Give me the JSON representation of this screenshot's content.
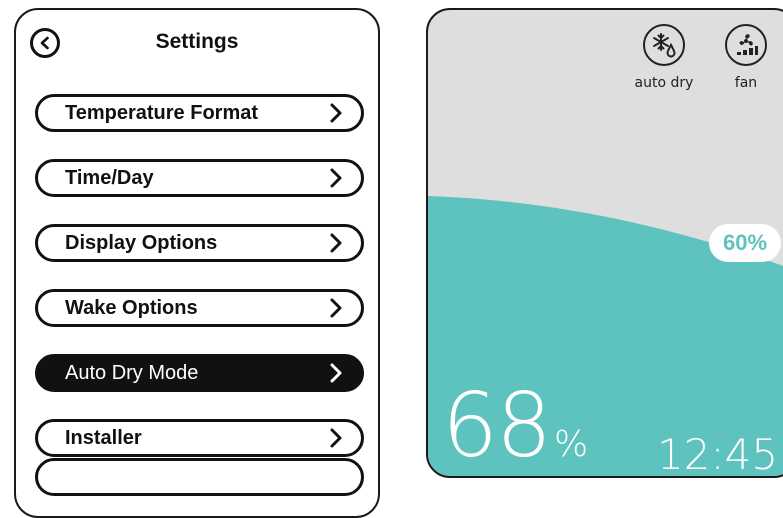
{
  "settings": {
    "title": "Settings",
    "back_icon": "chevron-left-icon",
    "items": [
      {
        "label": "Temperature Format",
        "active": false
      },
      {
        "label": "Time/Day",
        "active": false
      },
      {
        "label": "Display Options",
        "active": false
      },
      {
        "label": "Wake Options",
        "active": false
      },
      {
        "label": "Auto Dry Mode",
        "active": true
      },
      {
        "label": "Installer",
        "active": false
      }
    ]
  },
  "thermostat": {
    "modes": [
      {
        "label": "auto dry",
        "icon": "snowflake-drop-icon"
      },
      {
        "label": "fan",
        "icon": "fan-icon"
      }
    ],
    "setpoint_badge": "60%",
    "humidity_value": "68",
    "humidity_unit": "%",
    "time": "12:45",
    "colors": {
      "water": "#5ec3be",
      "background": "#dedede",
      "active_item": "#111111"
    }
  }
}
